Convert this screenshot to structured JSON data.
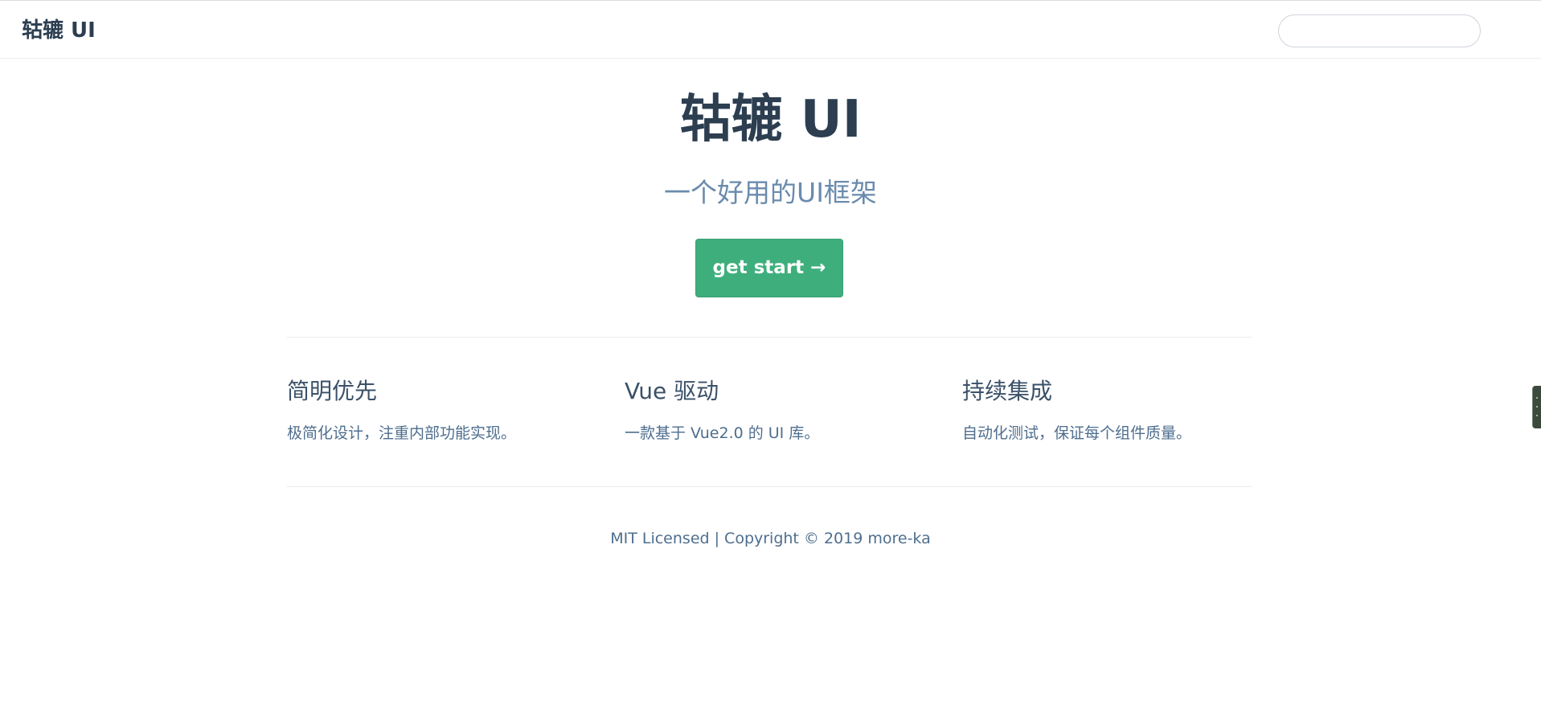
{
  "navbar": {
    "site_name": "轱辘 UI",
    "search_value": ""
  },
  "hero": {
    "title": "轱辘 UI",
    "description": "一个好用的UI框架",
    "action_label": "get start →"
  },
  "features": [
    {
      "title": "简明优先",
      "details": "极简化设计，注重内部功能实现。"
    },
    {
      "title": "Vue 驱动",
      "details": "一款基于 Vue2.0 的 UI 库。"
    },
    {
      "title": "持续集成",
      "details": "自动化测试，保证每个组件质量。"
    }
  ],
  "footer": {
    "text": "MIT Licensed | Copyright © 2019 more-ka"
  },
  "colors": {
    "accent": "#3eaf7c",
    "text": "#2c3e50",
    "description": "#6a8bad"
  }
}
